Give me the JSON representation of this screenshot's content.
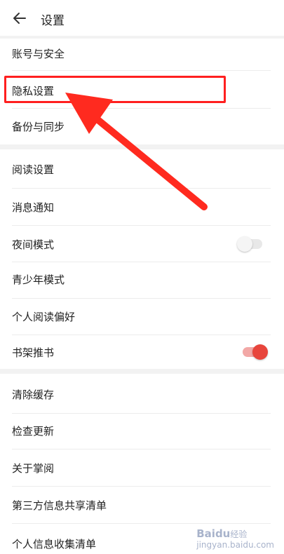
{
  "header": {
    "title": "设置"
  },
  "items": [
    {
      "label": "账号与安全"
    },
    {
      "label": "隐私设置"
    },
    {
      "label": "备份与同步"
    },
    {
      "label": "阅读设置"
    },
    {
      "label": "消息通知"
    },
    {
      "label": "夜间模式",
      "toggle": "off"
    },
    {
      "label": "青少年模式"
    },
    {
      "label": "个人阅读偏好"
    },
    {
      "label": "书架推书",
      "toggle": "on"
    },
    {
      "label": "清除缓存"
    },
    {
      "label": "检查更新"
    },
    {
      "label": "关于掌阅"
    },
    {
      "label": "第三方信息共享清单"
    },
    {
      "label": "个人信息收集清单"
    }
  ],
  "watermark": {
    "brand": "Baidu",
    "suffix": "经验",
    "domain": "jingyan.baidu.com"
  },
  "colors": {
    "accent": "#e8453c",
    "annotation": "#ff1f1f"
  }
}
